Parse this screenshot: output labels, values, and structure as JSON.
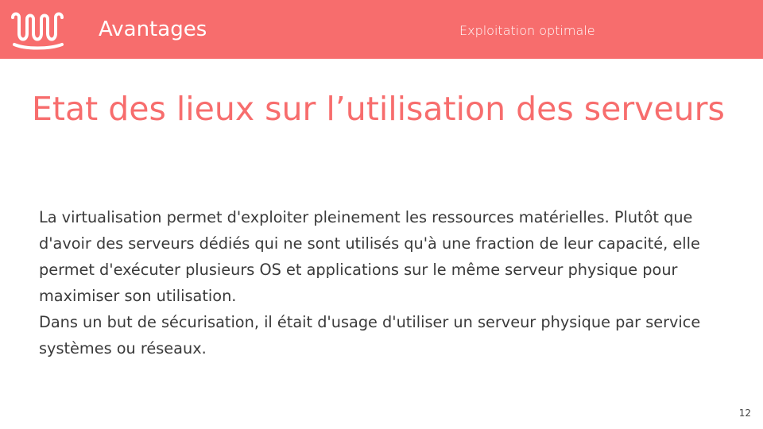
{
  "header": {
    "section_title": "Avantages",
    "section_subtitle": "Exploitation optimale",
    "logo": "wave-logo-icon"
  },
  "slide": {
    "title": "Etat des lieux sur l’utilisation des serveurs",
    "paragraphs": [
      "La virtualisation permet d'exploiter pleinement les ressources matérielles. Plutôt que d'avoir des serveurs dédiés qui ne sont utilisés qu'à une fraction de leur capacité, elle permet d'exécuter plusieurs OS et applications sur le même serveur physique pour maximiser son utilisation.",
      "Dans un but de sécurisation, il était d'usage d'utiliser un serveur physique par service systèmes ou réseaux."
    ],
    "page_number": "12"
  },
  "colors": {
    "accent": "#f76d6d",
    "text": "#3a3a3a",
    "header_text": "#ffffff"
  }
}
